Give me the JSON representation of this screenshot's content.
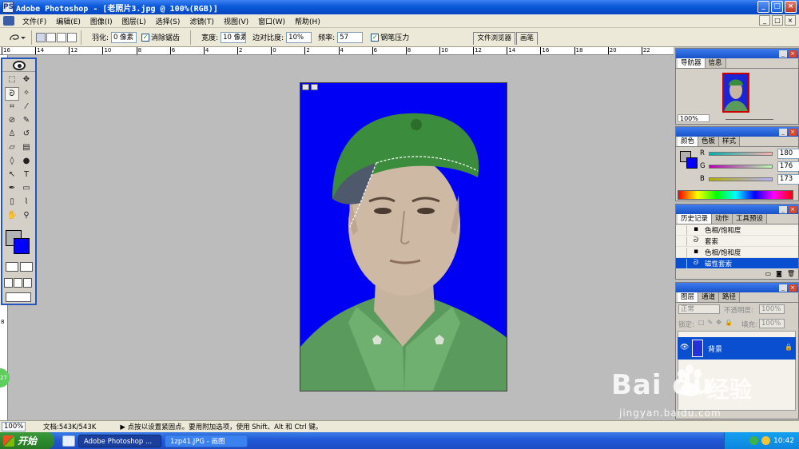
{
  "window": {
    "title": "Adobe Photoshop - [老照片3.jpg @ 100%(RGB)]",
    "app_icon": "PS",
    "controls": [
      "_",
      "□",
      "×"
    ]
  },
  "menu": {
    "items": [
      "文件(F)",
      "编辑(E)",
      "图像(I)",
      "图层(L)",
      "选择(S)",
      "滤镜(T)",
      "视图(V)",
      "窗口(W)",
      "帮助(H)"
    ],
    "doc_controls": [
      "_",
      "□",
      "×"
    ]
  },
  "options": {
    "feather_label": "羽化:",
    "feather_value": "0 像素",
    "antialias_label": "消除锯齿",
    "width_label": "宽度:",
    "width_value": "10 像素",
    "contrast_label": "边对比度:",
    "contrast_value": "10%",
    "frequency_label": "频率:",
    "frequency_value": "57",
    "pen_pressure_label": "钢笔压力",
    "well_tabs": [
      "文件浏览器",
      "画笔"
    ]
  },
  "rulers": {
    "top_ticks": [
      "16",
      "14",
      "12",
      "10",
      "8",
      "6",
      "4",
      "2",
      "0",
      "2",
      "4",
      "6",
      "8",
      "10",
      "12",
      "14",
      "16",
      "18",
      "20",
      "22"
    ],
    "left_ticks": [
      "2",
      "0",
      "2",
      "4",
      "6",
      "8",
      "10"
    ]
  },
  "navigator": {
    "tabs": [
      "导航器",
      "信息"
    ],
    "zoom": "100%"
  },
  "color": {
    "tabs": [
      "颜色",
      "色板",
      "样式"
    ],
    "r_label": "R",
    "r_value": "180",
    "g_label": "G",
    "g_value": "176",
    "b_label": "B",
    "b_value": "173"
  },
  "history": {
    "tabs": [
      "历史记录",
      "动作",
      "工具预设"
    ],
    "items": [
      "色相/饱和度",
      "套索",
      "色相/饱和度",
      "磁性套索"
    ]
  },
  "layers": {
    "tabs": [
      "图层",
      "通道",
      "路径"
    ],
    "blend_mode": "正常",
    "opacity_label": "不透明度:",
    "opacity_value": "100%",
    "lock_label": "锁定:",
    "fill_label": "填充:",
    "fill_value": "100%",
    "layer_name": "背景"
  },
  "status": {
    "zoom": "100%",
    "doc_size": "文档:543K/543K",
    "hint": "▶ 点按以设置紧固点。要用附加选项，使用 Shift、Alt 和 Ctrl 键。"
  },
  "taskbar": {
    "start_label": "开始",
    "tasks": [
      "Adobe Photoshop ...",
      "1zp41.JPG - 画图"
    ],
    "clock": "10:42"
  },
  "watermark": {
    "brand": "Bai  du",
    "cn": "经验",
    "url": "jingyan.baidu.com"
  },
  "side_badge": "27",
  "colors": {
    "canvas_bg": "#0000f5",
    "foreground": "#b3b3b3",
    "background": "#0000ff",
    "title_blue": "#0a58d8",
    "selection_blue": "#0a4fcf"
  }
}
